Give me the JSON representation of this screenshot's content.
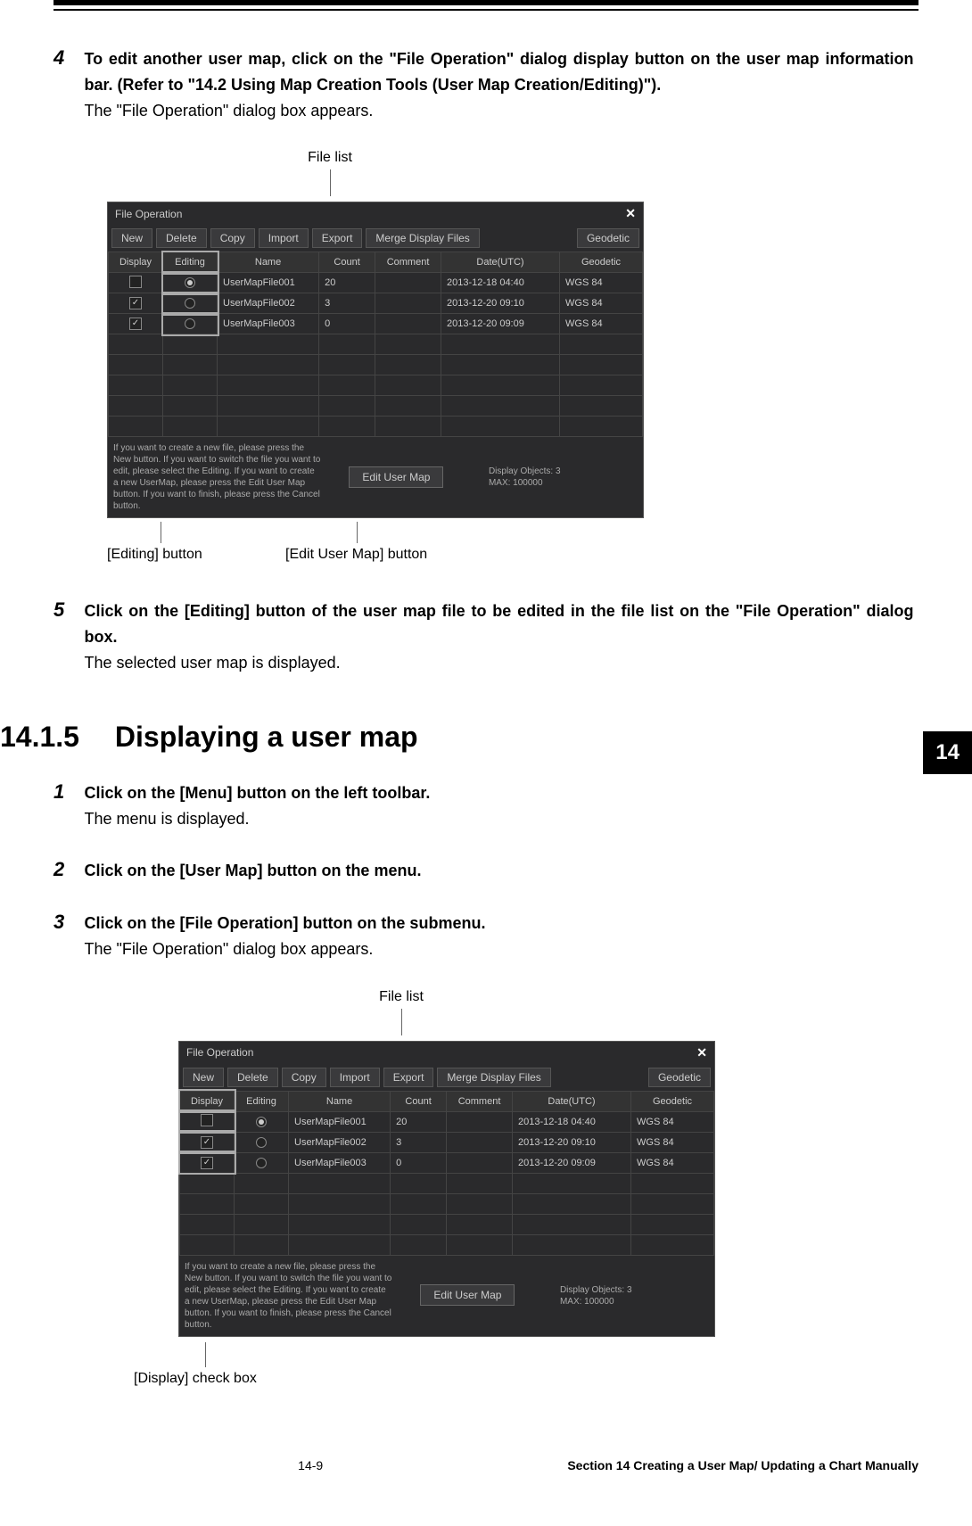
{
  "step4": {
    "num": "4",
    "bold": "To edit another user map, click on the \"File Operation\" dialog display button on the user map information bar. (Refer to \"14.2 Using Map Creation Tools (User Map Creation/Editing)\").",
    "plain": "The \"File Operation\" dialog box appears."
  },
  "ann_file_list": "File list",
  "dialog": {
    "title": "File Operation",
    "toolbar": {
      "new": "New",
      "delete": "Delete",
      "copy": "Copy",
      "import": "Import",
      "export": "Export",
      "merge": "Merge Display Files",
      "geodetic": "Geodetic"
    },
    "headers": {
      "display": "Display",
      "editing": "Editing",
      "name": "Name",
      "count": "Count",
      "comment": "Comment",
      "date": "Date(UTC)",
      "geodetic": "Geodetic"
    },
    "rows": [
      {
        "display": "",
        "editing": "on",
        "name": "UserMapFile001",
        "count": "20",
        "comment": "",
        "date": "2013-12-18 04:40",
        "geodetic": "WGS 84"
      },
      {
        "display": "✓",
        "editing": "",
        "name": "UserMapFile002",
        "count": "3",
        "comment": "",
        "date": "2013-12-20 09:10",
        "geodetic": "WGS 84"
      },
      {
        "display": "✓",
        "editing": "",
        "name": "UserMapFile003",
        "count": "0",
        "comment": "",
        "date": "2013-12-20 09:09",
        "geodetic": "WGS 84"
      }
    ],
    "foot_hint": "If you want to create a new file, please press the New button. If you want to switch the file you want to edit, please select the Editing. If you want to create a new UserMap, please press the Edit User Map button. If you want to finish, please press the Cancel button.",
    "edit_btn": "Edit User Map",
    "foot_right1": "Display Objects: 3",
    "foot_right2": "MAX: 100000"
  },
  "callouts1": {
    "editing": "[Editing] button",
    "editmap": "[Edit User Map] button"
  },
  "step5": {
    "num": "5",
    "bold": "Click on the [Editing] button of the user map file to be edited in the file list on the \"File Operation\" dialog box.",
    "plain": "The selected user map is displayed."
  },
  "tab_number": "14",
  "heading": {
    "num": "14.1.5",
    "title": "Displaying a user map"
  },
  "step1": {
    "num": "1",
    "bold": "Click on the [Menu] button on the left toolbar.",
    "plain": "The menu is displayed."
  },
  "step2": {
    "num": "2",
    "bold": "Click on the [User Map] button on the menu."
  },
  "step3": {
    "num": "3",
    "bold": "Click on the [File Operation] button on the submenu.",
    "plain": "The \"File Operation\" dialog box appears."
  },
  "callouts2": {
    "display": "[Display] check box"
  },
  "footer": {
    "page": "14-9",
    "section": "Section 14  Creating a User Map/ Updating a Chart Manually"
  }
}
